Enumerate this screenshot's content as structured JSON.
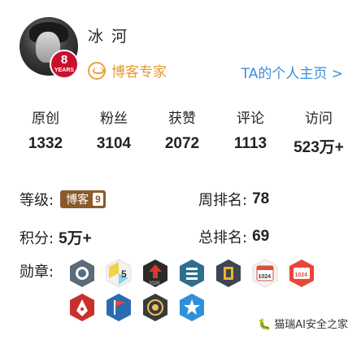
{
  "profile": {
    "name": "冰 河",
    "years_badge": {
      "number": "8",
      "label": "YEARS"
    },
    "title": "博客专家",
    "homepage_link": "TA的个人主页 >"
  },
  "stats": [
    {
      "label": "原创",
      "value": "1332"
    },
    {
      "label": "粉丝",
      "value": "3104"
    },
    {
      "label": "获赞",
      "value": "2072"
    },
    {
      "label": "评论",
      "value": "1113"
    },
    {
      "label": "访问",
      "value": "523万+"
    }
  ],
  "details": {
    "level_label": "等级:",
    "level_badge_text": "博客",
    "level_badge_num": "9",
    "weekly_rank_label": "周排名:",
    "weekly_rank_value": "78",
    "points_label": "积分:",
    "points_value": "5万+",
    "total_rank_label": "总排名:",
    "total_rank_value": "69"
  },
  "medals": {
    "label": "勋章:",
    "items": [
      {
        "icon": "github-medal-icon",
        "color": "#5a6b7b"
      },
      {
        "icon": "five-year-medal-icon",
        "color": "#f2d14b"
      },
      {
        "icon": "2020-medal-icon",
        "color": "#d63a2f",
        "text": "2020"
      },
      {
        "icon": "list-medal-icon",
        "color": "#2e6e8e"
      },
      {
        "icon": "streak-medal-icon",
        "color": "#3d4452"
      },
      {
        "icon": "1024-calendar-medal-icon",
        "color": "#e04b3a",
        "text": "1024"
      },
      {
        "icon": "1024-red-medal-icon",
        "color": "#e8463a",
        "text": "1024"
      },
      {
        "icon": "pen-medal-icon",
        "color": "#c9302c"
      },
      {
        "icon": "flag-medal-icon",
        "color": "#2b6cb0"
      },
      {
        "icon": "expert-medal-icon",
        "color": "#3a3a3a"
      },
      {
        "icon": "star-medal-icon",
        "color": "#2f8fd8"
      }
    ]
  },
  "watermark": "🐛 猫瑞AI安全之家"
}
